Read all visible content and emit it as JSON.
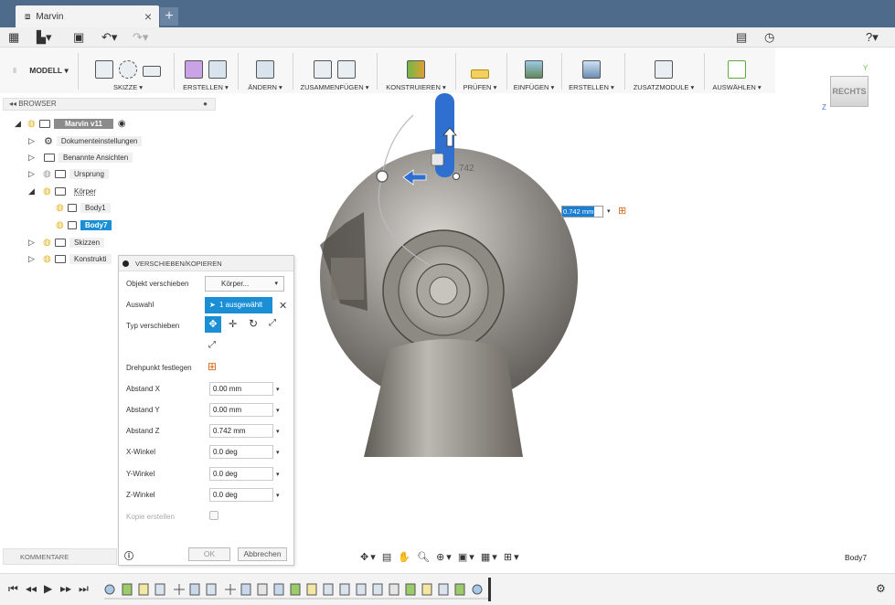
{
  "window": {
    "tab_title": "Marvin"
  },
  "ribbon": {
    "workspace": "MODELL",
    "groups": [
      "SKIZZE",
      "ERSTELLEN",
      "ÄNDERN",
      "ZUSAMMENFÜGEN",
      "KONSTRUIEREN",
      "PRÜFEN",
      "EINFÜGEN",
      "ERSTELLEN",
      "ZUSATZMODULE",
      "AUSWÄHLEN"
    ]
  },
  "viewcube": {
    "label": "RECHTS"
  },
  "browser": {
    "title": "BROWSER",
    "document": "Marvin v11",
    "items": [
      {
        "label": "Dokumenteinstellungen"
      },
      {
        "label": "Benannte Ansichten"
      },
      {
        "label": "Ursprung"
      },
      {
        "label": "Körper"
      },
      {
        "label": "Body1"
      },
      {
        "label": "Body7"
      },
      {
        "label": "Skizzen"
      },
      {
        "label": "Konstrukti"
      }
    ]
  },
  "move_panel": {
    "title": "VERSCHIEBEN/KOPIEREN",
    "object_move_label": "Objekt verschieben",
    "object_move_value": "Körper...",
    "selection_label": "Auswahl",
    "selection_value": "1 ausgewählt",
    "move_type_label": "Typ verschieben",
    "pivot_label": "Drehpunkt festlegen",
    "fields": [
      {
        "label": "Abstand X",
        "value": "0.00 mm"
      },
      {
        "label": "Abstand Y",
        "value": "0.00 mm"
      },
      {
        "label": "Abstand Z",
        "value": "0.742 mm"
      },
      {
        "label": "X-Winkel",
        "value": "0.0 deg"
      },
      {
        "label": "Y-Winkel",
        "value": "0.0 deg"
      },
      {
        "label": "Z-Winkel",
        "value": "0.0 deg"
      }
    ],
    "copy_label": "Kopie erstellen",
    "ok_label": "OK",
    "cancel_label": "Abbrechen"
  },
  "viewport": {
    "dimension_input": "0.742 mm",
    "gizmo_label": "742"
  },
  "comments": {
    "label": "KOMMENTARE"
  },
  "status": {
    "selected_body": "Body7"
  },
  "colors": {
    "accent": "#1a8fd6",
    "tabbar": "#4e6b8b",
    "gizmo": "#2f6fd0"
  }
}
